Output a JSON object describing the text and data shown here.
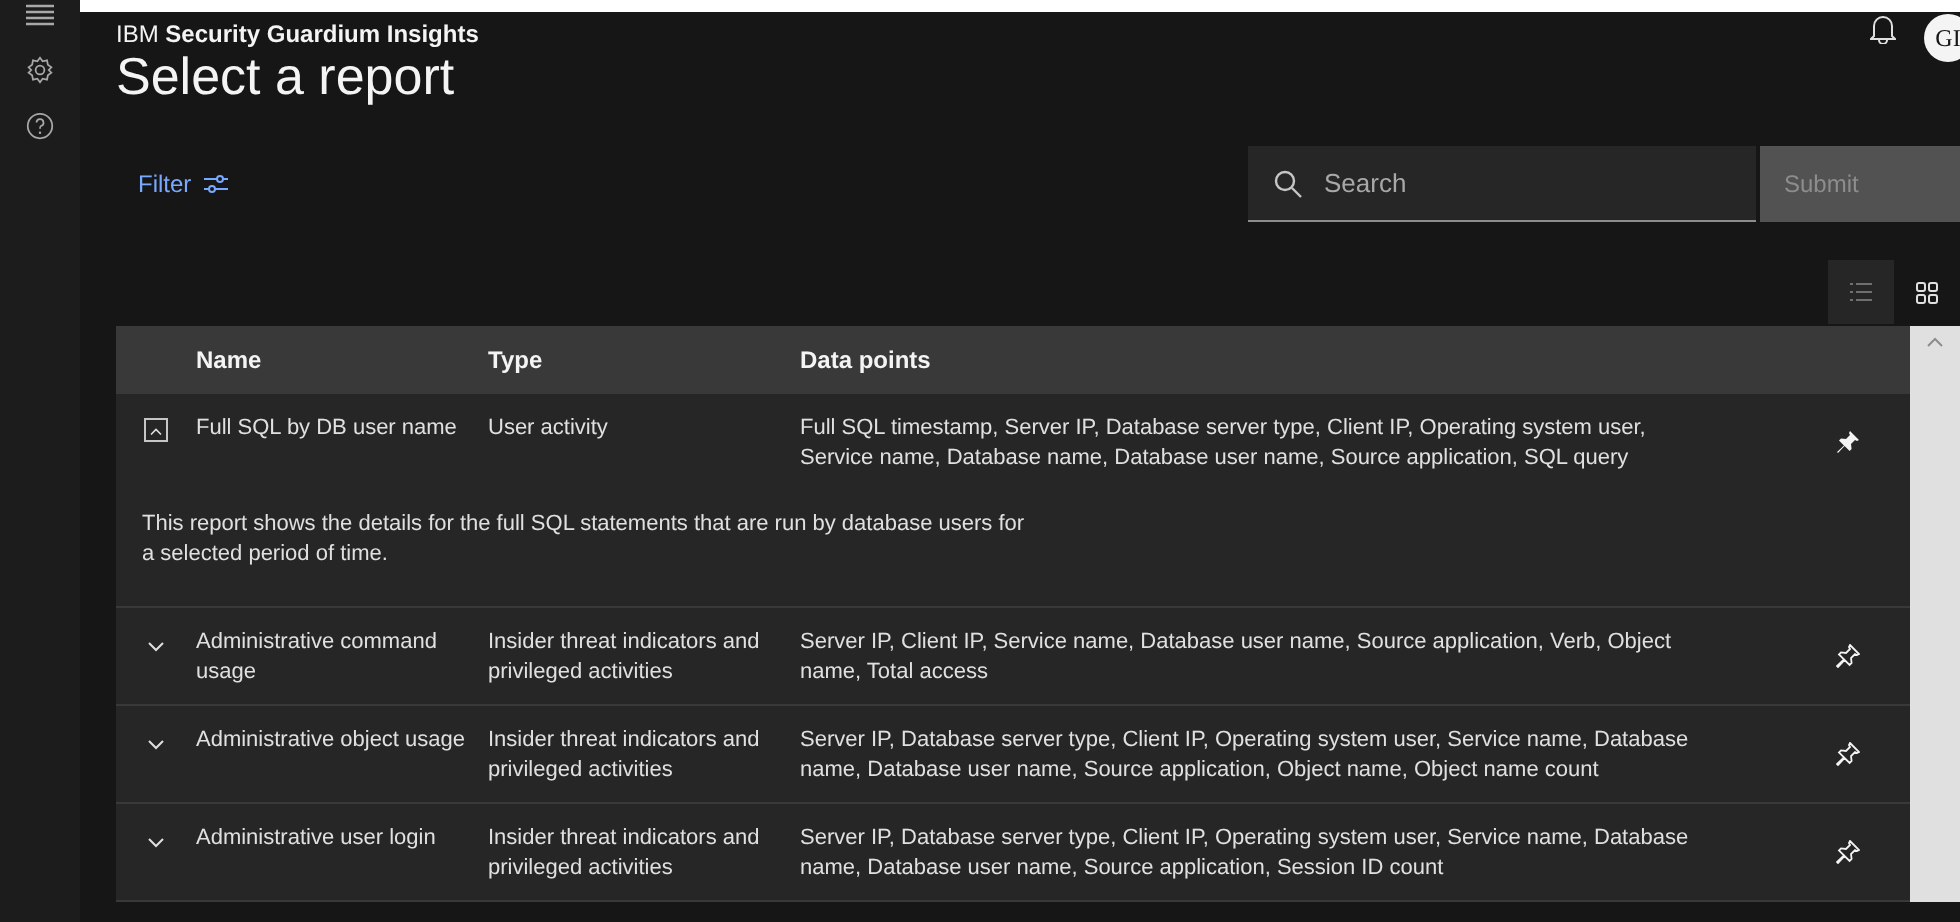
{
  "brand": {
    "prefix": "IBM",
    "name": "Security Guardium Insights"
  },
  "page_title": "Select a report",
  "avatar": "GI",
  "filter": {
    "label": "Filter"
  },
  "search": {
    "placeholder": "Search"
  },
  "submit": {
    "label": "Submit",
    "disabled": true
  },
  "view_toggle": [
    {
      "kind": "list",
      "selected": true
    },
    {
      "kind": "grid",
      "selected": false
    }
  ],
  "table": {
    "columns": [
      "Name",
      "Type",
      "Data points"
    ],
    "rows": [
      {
        "name": "Full SQL by DB user name",
        "type": "User activity",
        "data_points": "Full SQL timestamp, Server IP, Database server type, Client IP, Operating system user, Service name, Database name, Database user name, Source application, SQL query",
        "expanded": true,
        "pinned": true,
        "description": "This report shows the details for the full SQL statements that are run by database users for a selected period of time."
      },
      {
        "name": "Administrative command usage",
        "type": "Insider threat indicators and privileged activities",
        "data_points": "Server IP, Client IP, Service name, Database user name, Source application, Verb, Object name, Total access",
        "expanded": false,
        "pinned": false
      },
      {
        "name": "Administrative object usage",
        "type": "Insider threat indicators and privileged activities",
        "data_points": "Server IP, Database server type, Client IP, Operating system user, Service name, Database name, Database user name, Source application, Object name, Object name count",
        "expanded": false,
        "pinned": false
      },
      {
        "name": "Administrative user login",
        "type": "Insider threat indicators and privileged activities",
        "data_points": "Server IP, Database server type, Client IP, Operating system user, Service name, Database name, Database user name, Source application, Session ID count",
        "expanded": false,
        "pinned": false
      }
    ]
  }
}
